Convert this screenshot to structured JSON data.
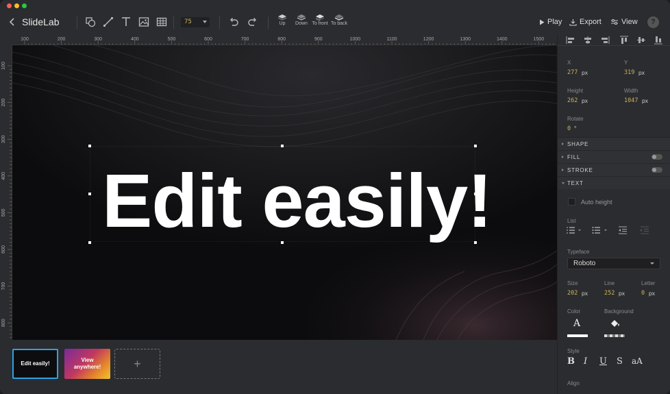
{
  "app": {
    "title": "SlideLab"
  },
  "toolbar": {
    "zoom": "75",
    "layer_buttons": [
      "Up",
      "Down",
      "To front",
      "To back"
    ],
    "play_label": "Play",
    "export_label": "Export",
    "view_label": "View",
    "help_label": "?"
  },
  "ruler": {
    "top": [
      "100",
      "200",
      "300",
      "400",
      "500",
      "600",
      "700",
      "800",
      "900",
      "1000",
      "1100",
      "1200",
      "1300",
      "1400",
      "1500"
    ],
    "left": [
      "100",
      "200",
      "300",
      "400",
      "500",
      "600",
      "700",
      "800"
    ]
  },
  "canvas": {
    "headline": "Edit easily!"
  },
  "slides": [
    {
      "label": "Edit easily!"
    },
    {
      "label": "View anywhere!"
    }
  ],
  "slides_add_label": "+",
  "panel": {
    "position": {
      "x_label": "X",
      "x": "277",
      "y_label": "Y",
      "y": "319",
      "height_label": "Height",
      "height": "262",
      "width_label": "Width",
      "width": "1047",
      "rotate_label": "Rotate",
      "rotate": "0",
      "unit": "px",
      "deg": "°"
    },
    "sections": {
      "shape": "SHAPE",
      "fill": "FILL",
      "stroke": "STROKE",
      "text": "TEXT"
    },
    "text": {
      "auto_height": "Auto height",
      "list_label": "List",
      "typeface_label": "Typeface",
      "typeface": "Roboto",
      "size_label": "Size",
      "size": "202",
      "line_label": "Line",
      "line": "252",
      "letter_label": "Letter",
      "letter": "0",
      "unit": "px",
      "color_label": "Color",
      "background_label": "Background",
      "style_label": "Style",
      "styles": [
        "B",
        "I",
        "U",
        "S",
        "aA"
      ],
      "align_label": "Align",
      "color_glyph": "A"
    }
  },
  "colors": {
    "accent": "#2aa3e8",
    "value": "#c9b35a",
    "canvas": "#0c0c0e",
    "panel": "#2b2c2f"
  }
}
